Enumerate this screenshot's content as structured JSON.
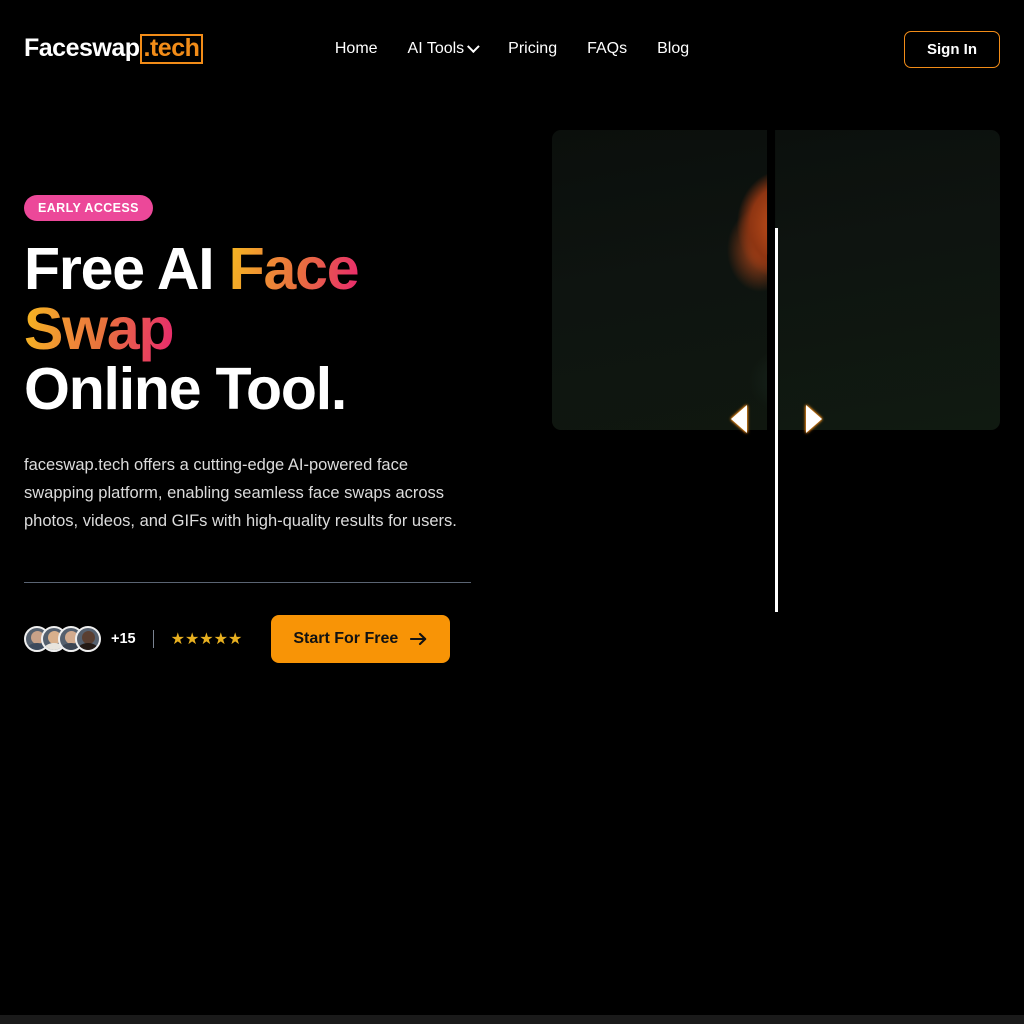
{
  "header": {
    "logo": {
      "main": "Faceswap",
      "tld": ".tech"
    },
    "nav": [
      {
        "label": "Home",
        "icon": null
      },
      {
        "label": "AI Tools",
        "icon": "chevron-down-icon"
      },
      {
        "label": "Pricing",
        "icon": null
      },
      {
        "label": "FAQs",
        "icon": null
      },
      {
        "label": "Blog",
        "icon": null
      }
    ],
    "signin_label": "Sign In"
  },
  "hero": {
    "badge": "EARLY ACCESS",
    "headline": {
      "line1_plain": "Free AI ",
      "line1_grad": "Face",
      "line2_grad": "Swap",
      "line3_plain": "Online Tool."
    },
    "subtitle": "faceswap.tech offers a cutting-edge AI-powered face swapping platform, enabling seamless face swaps across photos, videos, and GIFs with high-quality results for users.",
    "social_proof": {
      "extra_count": "+15",
      "stars": "★★★★★",
      "star_count": 5
    },
    "cta_label": "Start For Free",
    "cta_icon": "arrow-right-icon"
  },
  "compare": {
    "left_handle_icon": "arrow-left-icon",
    "right_handle_icon": "arrow-right-icon"
  },
  "colors": {
    "background": "#000000",
    "accent_orange": "#F28C18",
    "cta_orange": "#F89406",
    "badge_pink": "#EC4899",
    "gradient_start": "#F5B820",
    "gradient_mid": "#EE8439",
    "gradient_end": "#E8296E",
    "star_gold": "#E8B020",
    "text_primary": "#FFFFFF",
    "text_muted": "#DCDCDC",
    "divider": "#5A6473"
  }
}
